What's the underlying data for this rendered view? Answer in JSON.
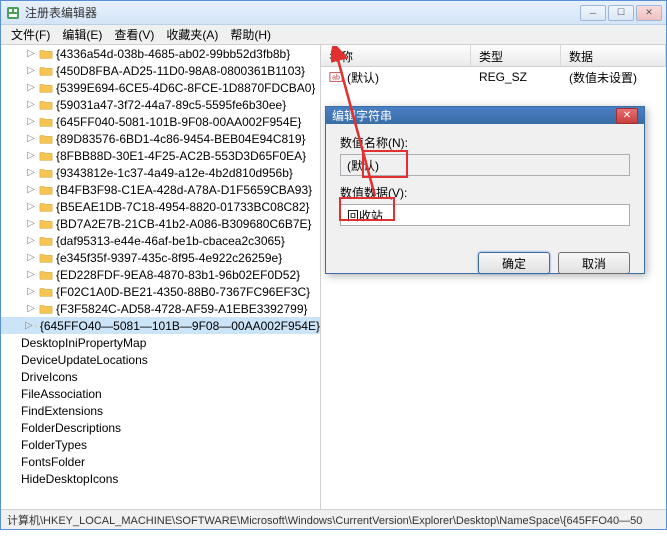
{
  "window": {
    "title": "注册表编辑器"
  },
  "menu": {
    "file": "文件(F)",
    "edit": "编辑(E)",
    "view": "查看(V)",
    "favorites": "收藏夹(A)",
    "help": "帮助(H)"
  },
  "tree": {
    "items": [
      "{4336a54d-038b-4685-ab02-99bb52d3fb8b}",
      "{450D8FBA-AD25-11D0-98A8-0800361B1103}",
      "{5399E694-6CE5-4D6C-8FCE-1D8870FDCBA0}",
      "{59031a47-3f72-44a7-89c5-5595fe6b30ee}",
      "{645FF040-5081-101B-9F08-00AA002F954E}",
      "{89D83576-6BD1-4c86-9454-BEB04E94C819}",
      "{8FBB88D-30E1-4F25-AC2B-553D3D65F0EA}",
      "{9343812e-1c37-4a49-a12e-4b2d810d956b}",
      "{B4FB3F98-C1EA-428d-A78A-D1F5659CBA93}",
      "{B5EAE1DB-7C18-4954-8820-01733BC08C82}",
      "{BD7A2E7B-21CB-41b2-A086-B309680C6B7E}",
      "{daf95313-e44e-46af-be1b-cbacea2c3065}",
      "{e345f35f-9397-435c-8f95-4e922c26259e}",
      "{ED228FDF-9EA8-4870-83b1-96b02EF0D52}",
      "{F02C1A0D-BE21-4350-88B0-7367FC96EF3C}",
      "{F3F5824C-AD58-4728-AF59-A1EBE3392799}",
      "{645FFO40—5081—101B—9F08—00AA002F954E}"
    ],
    "siblings": [
      "DesktopIniPropertyMap",
      "DeviceUpdateLocations",
      "DriveIcons",
      "FileAssociation",
      "FindExtensions",
      "FolderDescriptions",
      "FolderTypes",
      "FontsFolder",
      "HideDesktopIcons"
    ]
  },
  "list": {
    "col_name": "名称",
    "col_type": "类型",
    "col_data": "数据",
    "row": {
      "name": "(默认)",
      "type": "REG_SZ",
      "data": "(数值未设置)"
    }
  },
  "dialog": {
    "title": "编辑字符串",
    "name_label": "数值名称(N):",
    "name_value": "(默认)",
    "data_label": "数值数据(V):",
    "data_value": "回收站",
    "ok": "确定",
    "cancel": "取消"
  },
  "statusbar": {
    "path": "计算机\\HKEY_LOCAL_MACHINE\\SOFTWARE\\Microsoft\\Windows\\CurrentVersion\\Explorer\\Desktop\\NameSpace\\{645FFO40—50"
  }
}
